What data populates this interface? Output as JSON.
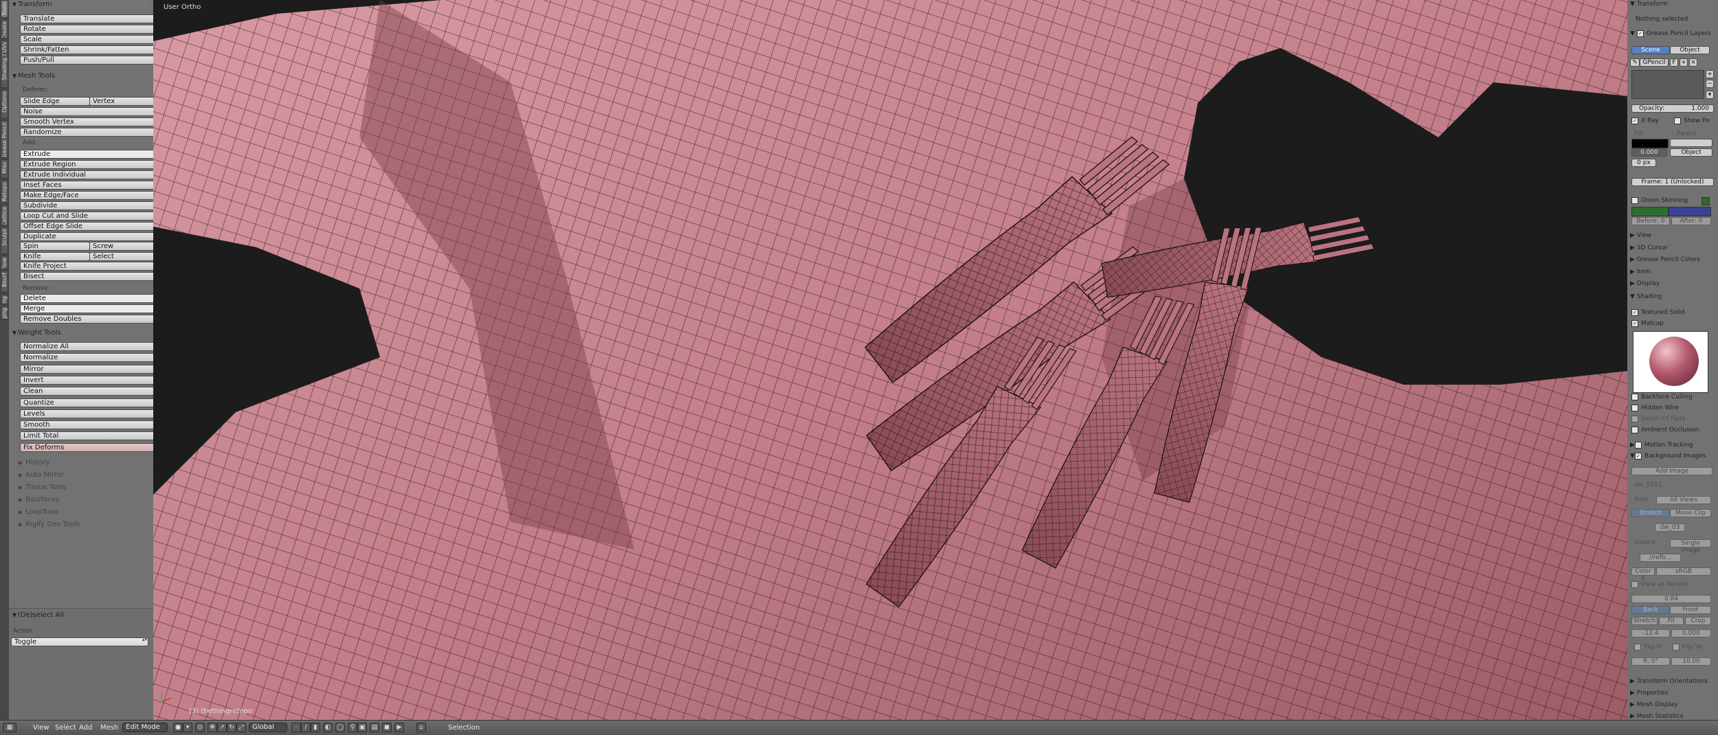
{
  "tabs": [
    "Tools",
    "Create",
    "Shading / UVs",
    "Options",
    "Grease Pencil",
    "Misc",
    "Retopo",
    "Lattice",
    "Sculpt",
    "RetopoFlow",
    "Bsurf",
    "Modeling",
    "Rigging"
  ],
  "transform": {
    "title": "Transform",
    "buttons": [
      "Translate",
      "Rotate",
      "Scale",
      "Shrink/Fatten",
      "Push/Pull"
    ]
  },
  "mesh_tools": {
    "title": "Mesh Tools",
    "deform_label": "Deform:",
    "slide_edge": "Slide Edge",
    "vertex": "Vertex",
    "deform_buttons": [
      "Noise",
      "Smooth Vertex",
      "Randomize"
    ],
    "add_label": "Add:",
    "extrude": "Extrude",
    "add_buttons": [
      "Extrude Region",
      "Extrude Individual",
      "Inset Faces",
      "Make Edge/Face",
      "Subdivide",
      "Loop Cut and Slide",
      "Offset Edge Slide",
      "Duplicate"
    ],
    "spin": "Spin",
    "screw": "Screw",
    "knife": "Knife",
    "select": "Select",
    "knife_project": "Knife Project",
    "bisect": "Bisect",
    "remove_label": "Remove:",
    "delete": "Delete",
    "merge": "Merge",
    "remove_doubles": "Remove Doubles"
  },
  "weight_tools": {
    "title": "Weight Tools",
    "buttons": [
      "Normalize All",
      "Normalize",
      "Mirror",
      "Invert",
      "Clean",
      "Quantize",
      "Levels",
      "Smooth",
      "Limit Total",
      "Fix Deforms"
    ]
  },
  "collapsed_panels": [
    "History",
    "Auto Mirror",
    "Tissue Tools",
    "Bsurfaces",
    "LoopTools",
    "Rigify Dev Tools"
  ],
  "operator": {
    "title": "(De)select All",
    "action_label": "Action",
    "action_value": "Toggle"
  },
  "viewport": {
    "view_name": "User Ortho",
    "object_label": "(3) thethingretopo",
    "mesh_color": "#c9848f",
    "wire_color": "#1a0f12"
  },
  "properties": {
    "transform_header": "Transform",
    "nothing_selected": "Nothing selected",
    "gp_layers": "Grease Pencil Layers",
    "scene": "Scene",
    "object": "Object",
    "gpencil": "GPencil",
    "f_label": "F",
    "opacity_label": "Opacity:",
    "opacity_value": "1.000",
    "xray": "X Ray",
    "show_points": "Show Po",
    "fill": "Fill",
    "parent": "Parent",
    "thickness": "0.000",
    "parent_type": "Object",
    "px": "0 px",
    "frame": "Frame: 1 (Unlocked)",
    "onion": "Onion Skinning",
    "before": "Before: 0",
    "after": "After: 0",
    "collapsed": [
      "View",
      "3D Cursor",
      "Grease Pencil Colors",
      "Item",
      "Display"
    ],
    "shading": "Shading",
    "textured_solid": "Textured Solid",
    "matcap": "Matcap",
    "matcap_color": "#b5596e",
    "shading_opts": [
      "Backface Culling",
      "Hidden Wire",
      "Depth Of Field",
      "Ambient Occlusion"
    ],
    "motion_tracking": "Motion Tracking",
    "background_images": "Background Images",
    "add_image": "Add Image",
    "image_name": "dw_0311...",
    "axis": "Axis:",
    "all_views": "All Views",
    "stretch": "Stretch",
    "move_clip": "Move Clip",
    "img_file": "dw_03",
    "source": "Source:",
    "single_image": "Single Image",
    "res_path": "//refb...",
    "color_space": "Color S",
    "srgb": "sRGB",
    "view_as_render": "View as Render",
    "opacity2": "0.84",
    "back": "Back",
    "front": "Front",
    "stretch2": "Stretch",
    "fit": "Fit",
    "crop": "Crop",
    "x_val": "-12.4",
    "y_val": "0.000",
    "flip_h": "Flip H",
    "flip_v": "Flip Ve",
    "rot": "R: 0°",
    "size": "10.00",
    "bottom_items": [
      "Transform Orientations",
      "Properties",
      "Mesh Display",
      "Mesh Statistics"
    ]
  },
  "header": {
    "menus": [
      "View",
      "Select",
      "Add",
      "Mesh"
    ],
    "mode": "Edit Mode",
    "orientation": "Global",
    "status": "Selection"
  }
}
